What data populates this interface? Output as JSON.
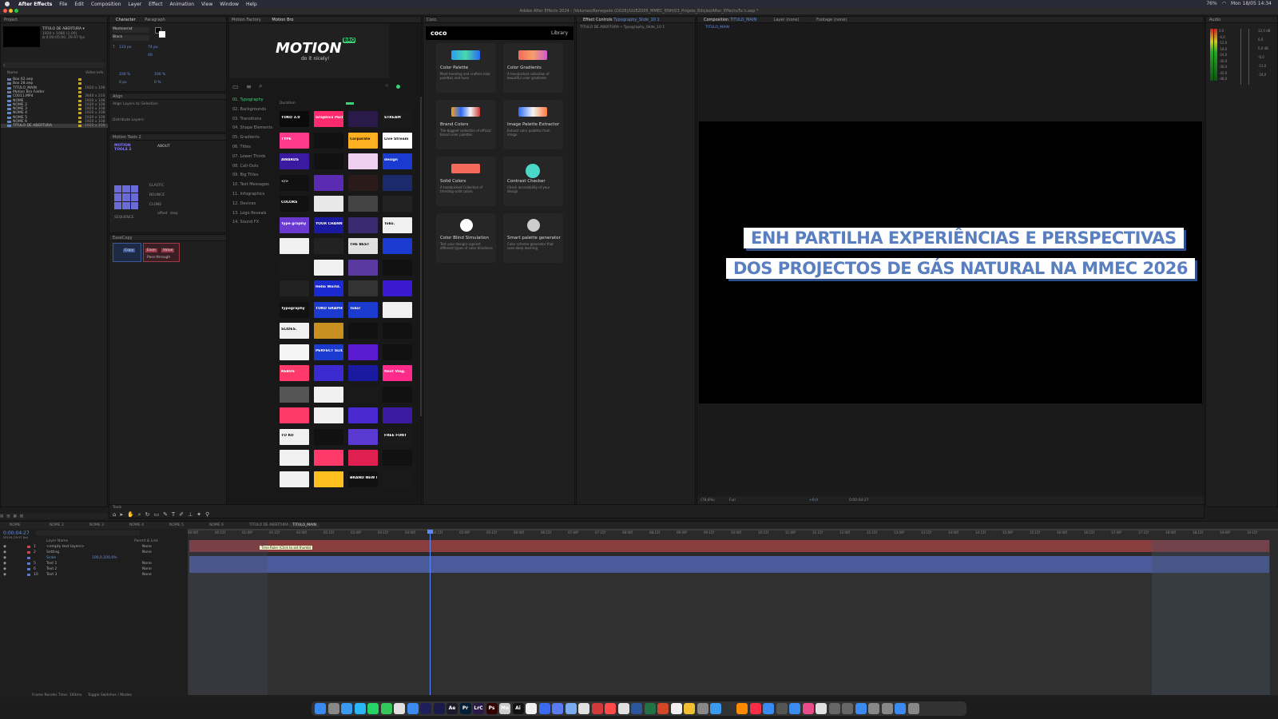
{
  "menubar": {
    "app": "After Effects",
    "items": [
      "File",
      "Edit",
      "Composition",
      "Layer",
      "Effect",
      "Animation",
      "View",
      "Window",
      "Help"
    ],
    "battery": "76%",
    "clock": "Mon 18/05 14:34"
  },
  "window_title": "Adobe After Effects 2024 - /Volumes/Renegade (D028)/GUEZ005_MMEC_ENH/03_Projeto_Edição/After_Effects/5c's.aep *",
  "project": {
    "tab": "Project",
    "comp_name": "TITULO DE ABERTURA ▾",
    "comp_info1": "1920 x 1080 (1.00)",
    "comp_info2": "Δ 0;00;05;00, 29.97 fps",
    "col_name": "Name",
    "col_info": "Video Info",
    "items": [
      {
        "name": "Box 02.aep",
        "info": ""
      },
      {
        "name": "Box 28.aep",
        "info": ""
      },
      {
        "name": "TITULO_MAIN",
        "info": "1920 x 108"
      },
      {
        "name": "Motion Bro Folder",
        "info": ""
      },
      {
        "name": "C0011.MP4",
        "info": "3840 x 216"
      },
      {
        "name": "NOME",
        "info": "1920 x 108"
      },
      {
        "name": "NOME 2",
        "info": "1920 x 108"
      },
      {
        "name": "NOME 3",
        "info": "1920 x 108"
      },
      {
        "name": "NOME 4",
        "info": "1920 x 108"
      },
      {
        "name": "NOME 5",
        "info": "1920 x 108"
      },
      {
        "name": "NOME 6",
        "info": "1920 x 108"
      },
      {
        "name": "TITULO DE ABERTURA",
        "info": "1920 x 108"
      }
    ]
  },
  "character": {
    "tab": "Character",
    "tab2": "Paragraph",
    "font": "Montserrat",
    "style": "Black",
    "size": "133 px",
    "leading": "74 px",
    "tracking": "40",
    "scale_v": "100 %",
    "scale_h": "100 %",
    "baseline": "0 px",
    "tsume": "0 %"
  },
  "align": {
    "tab": "Align",
    "align_to": "Align Layers to:",
    "align_to_val": "Selection",
    "distribute": "Distribute Layers:"
  },
  "motion_tools": {
    "tab": "Motion Tools 2",
    "about": "ABOUT",
    "elastic": "ELASTIC",
    "bounce": "BOUNCE",
    "clone": "CLONE",
    "sequence": "SEQUENCE",
    "offset": "offset",
    "step": "step"
  },
  "ezcopy": {
    "tab": "EaseCopy",
    "copy": "Copy",
    "paste": "Paste",
    "ease": "Ease",
    "value": "Value",
    "pass": "Pass-through"
  },
  "motionbro": {
    "tab1": "Motion Factory",
    "tab2": "Motion Bro",
    "logo": "MOTION",
    "logo_badge": "BRO",
    "tagline": "do it nicely!",
    "categories": [
      "01. Typography",
      "02. Backgrounds",
      "03. Transitions",
      "04. Shape Elements",
      "05. Gradients",
      "06. Titles",
      "07. Lower Thirds",
      "08. Call-Outs",
      "09. Big Titles",
      "10. Text Messages",
      "11. Infographics",
      "12. Devices",
      "13. Logo Reveals",
      "14. Sound FX"
    ],
    "duration_label": "Duration",
    "thumbs": [
      "TOKO 3.0",
      "Graphics Pack",
      "",
      "STREAM",
      "TYPE",
      "",
      "Corporate",
      "Live Stream",
      "AWARDS",
      "",
      "",
      "design",
      "</>",
      "",
      "",
      "",
      "COLORS",
      "",
      "",
      "",
      "Type graphy",
      "YOUR CHANNEL",
      "",
      "Toko.",
      "",
      "",
      "THE BEST",
      "",
      "",
      "",
      "",
      "",
      "",
      "Hello World.",
      "",
      "",
      "Typography",
      "TOKO GRAPHICS",
      "Toko!",
      "",
      "SLIDES.",
      "",
      "",
      "",
      "",
      "PERFECT SLIDES",
      "",
      "",
      "REBUS",
      "",
      "",
      "Next Vlog.",
      "",
      "",
      "",
      "",
      "",
      "",
      "",
      "",
      "TO KO",
      "",
      "",
      "FREE FONT",
      "",
      "",
      "",
      "",
      "",
      "",
      "BRAND NEW PROJECT",
      ""
    ]
  },
  "coco": {
    "tab": "Coco",
    "brand": "coco",
    "library": "Library",
    "cards": [
      {
        "title": "Color Palette",
        "desc": "Most trending and crafted color palettes and hues"
      },
      {
        "title": "Color Gradients",
        "desc": "A handpicked collection of beautiful color gradients"
      },
      {
        "title": "Brand Colors",
        "desc": "The biggest collection of official brand color palettes"
      },
      {
        "title": "Image Palette Extractor",
        "desc": "Extract color palettes from image"
      },
      {
        "title": "Solid Colors",
        "desc": "A handpicked Collection of trending solid colors"
      },
      {
        "title": "Contrast Checker",
        "desc": "Check accessibility of your design"
      },
      {
        "title": "Color Blind Simulation",
        "desc": "Test your designs against different types of color blindness"
      },
      {
        "title": "Smart palette generator",
        "desc": "Color scheme generator that uses deep learning"
      }
    ]
  },
  "effect_controls": {
    "tab": "Effect Controls",
    "layer": "Typography_Slide_10 1",
    "path": "TITULO DE ABERTURA • Typography_Slide_10 1"
  },
  "composition": {
    "tab": "Composition",
    "name": "TITULO_MAIN",
    "tab_layer": "Layer (none)",
    "tab_footage": "Footage (none)",
    "flow": "TITULO_MAIN",
    "line1": "ENH PARTILHA EXPERIÊNCIAS E PERSPECTIVAS",
    "line2": "DOS PROJECTOS DE GÁS NATURAL NA MMEC 2026",
    "zoom": "(78,8%)",
    "res": "Full",
    "plus": "+0,0",
    "time": "0:00:04:27"
  },
  "audio": {
    "tab": "Audio",
    "levels": [
      "0,0",
      "-6,0",
      "-12,0",
      "-18,0",
      "-24,0",
      "-30,0",
      "-36,0",
      "-42,0",
      "-48,0"
    ],
    "db_right": [
      "12,0 dB",
      "6,0",
      "0,0 dB",
      "-6,0",
      "-12,0",
      "-18,0"
    ]
  },
  "tools": {
    "tab": "Tools"
  },
  "timeline": {
    "tabs": [
      "NOME",
      "NOME 2",
      "NOME 3",
      "NOME 4",
      "NOME 5",
      "NOME 6",
      "TITULO DE ABERTURA",
      "TITULO_MAIN"
    ],
    "timecode": "0:00:04:27",
    "fps": "00149 (29.97 fps)",
    "col_layer": "Layer Name",
    "col_parent": "Parent & Link",
    "layers": [
      {
        "num": "1",
        "name": "<empty text layers>",
        "parent": "None"
      },
      {
        "num": "2",
        "name": "Setting",
        "parent": "None"
      },
      {
        "num": "",
        "name": "Scale",
        "parent": "100,0,100,0%"
      },
      {
        "num": "5",
        "name": "Text 1",
        "parent": "None"
      },
      {
        "num": "6",
        "name": "Text 2",
        "parent": "None"
      },
      {
        "num": "10",
        "name": "Text 3",
        "parent": "None"
      }
    ],
    "ruler": [
      "00:00f",
      "00:15f",
      "01:00f",
      "01:15f",
      "02:00f",
      "02:15f",
      "03:00f",
      "03:15f",
      "04:00f",
      "04:15f",
      "05:00f",
      "05:15f",
      "06:00f",
      "06:15f",
      "07:00f",
      "07:15f",
      "08:00f",
      "08:15f",
      "09:00f",
      "09:15f",
      "10:00f",
      "10:15f",
      "11:00f",
      "11:15f",
      "12:00f",
      "12:15f",
      "13:00f",
      "13:15f",
      "14:00f",
      "14:15f",
      "15:00f",
      "15:15f",
      "16:00f",
      "16:15f",
      "17:00f",
      "17:15f",
      "18:00f",
      "18:15f",
      "19:00f",
      "19:15f"
    ],
    "tooltip": "Time Ruler (Click to set thumb)",
    "footer_render": "Frame Render Time: 193ms",
    "footer_toggle": "Toggle Switches / Modes"
  },
  "dock": [
    "",
    "",
    "",
    "",
    "",
    "",
    "",
    "",
    "",
    "",
    "Ae",
    "Pr",
    "LrC",
    "Ps",
    "Me",
    "Ai",
    "",
    "",
    "",
    "",
    "",
    "",
    "",
    "",
    "",
    "",
    "",
    "",
    "",
    "",
    "",
    "",
    "",
    "",
    "",
    "",
    "",
    "",
    "",
    "",
    "",
    "",
    "",
    "",
    "",
    ""
  ]
}
